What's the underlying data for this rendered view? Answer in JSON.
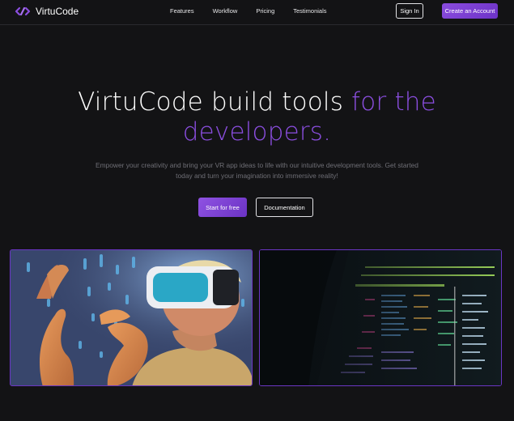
{
  "nav": {
    "brand": "VirtuCode",
    "links": [
      "Features",
      "Workflow",
      "Pricing",
      "Testimonials"
    ],
    "signin_label": "Sign In",
    "create_label": "Create an Account"
  },
  "hero": {
    "title_white": "VirtuCode build tools",
    "title_purple_1": "for the",
    "title_purple_2": "developers.",
    "subtitle_line1": "Empower your creativity and bring your VR app ideas to life with our intuitive development tools. Get started",
    "subtitle_line2": "today and turn your imagination into immersive reality!",
    "primary_cta": "Start for free",
    "secondary_cta": "Documentation"
  },
  "colors": {
    "accent": "#8b4ee0",
    "background": "#131315",
    "border": "#6b36c4"
  },
  "images": {
    "left": "vr-headset-person-image",
    "right": "code-terminal-screen-image"
  }
}
